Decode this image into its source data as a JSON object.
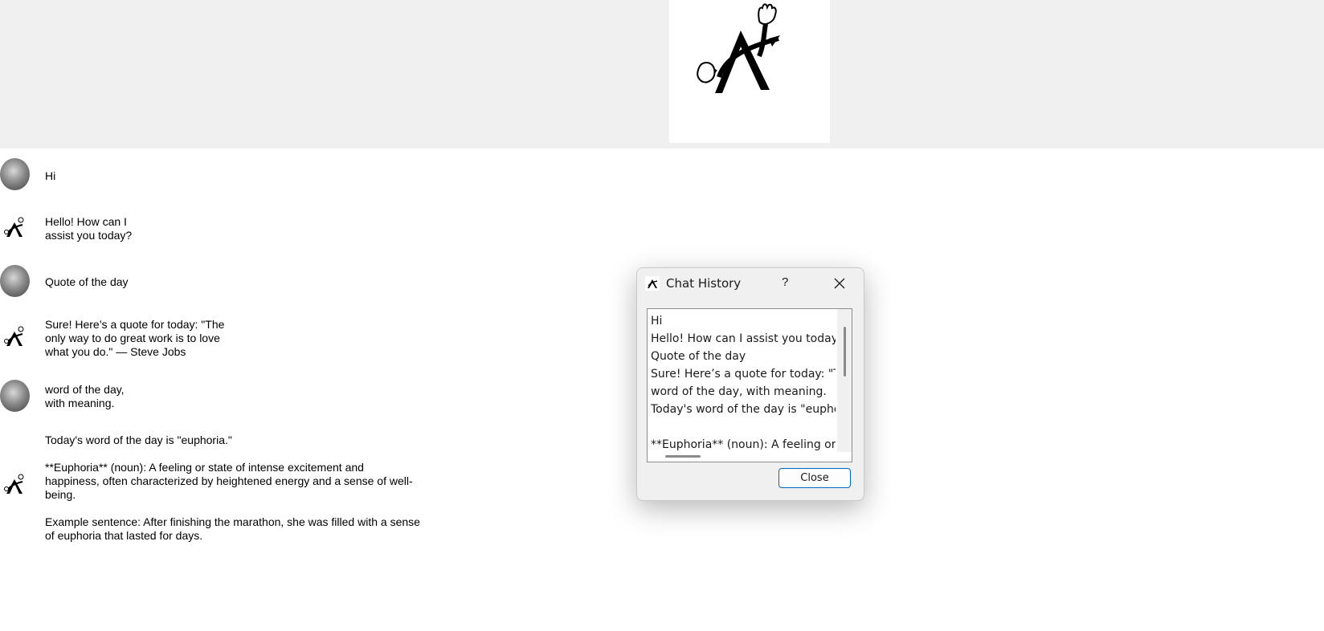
{
  "header": {
    "logo": "hand-arrow-logo-icon"
  },
  "chat": {
    "messages": [
      {
        "sender": "user",
        "text": "Hi"
      },
      {
        "sender": "bot",
        "text": "Hello! How can I\nassist you today?"
      },
      {
        "sender": "user",
        "text": "Quote of the day"
      },
      {
        "sender": "bot",
        "text": "Sure! Here’s a quote for today: \"The\nonly way to do great work is to love\nwhat you do.\" — Steve Jobs"
      },
      {
        "sender": "user",
        "text": "word of the day,\nwith meaning."
      },
      {
        "sender": "bot",
        "text": "Today's word of the day is \"euphoria.\"\n\n**Euphoria** (noun): A feeling or state of intense excitement and\nhappiness, often characterized by heightened energy and a sense of well-\nbeing.\n\nExample sentence: After finishing the marathon, she was filled with a sense\nof euphoria that lasted for days."
      }
    ]
  },
  "dialog": {
    "title": "Chat History",
    "help_label": "?",
    "close_label": "Close",
    "history_text": "Hi\nHello! How can I assist you today?\nQuote of the day\nSure! Here’s a quote for today: \"The\nword of the day, with meaning.\nToday's word of the day is \"euphoria.\"\n\n**Euphoria** (noun): A feeling or state"
  }
}
